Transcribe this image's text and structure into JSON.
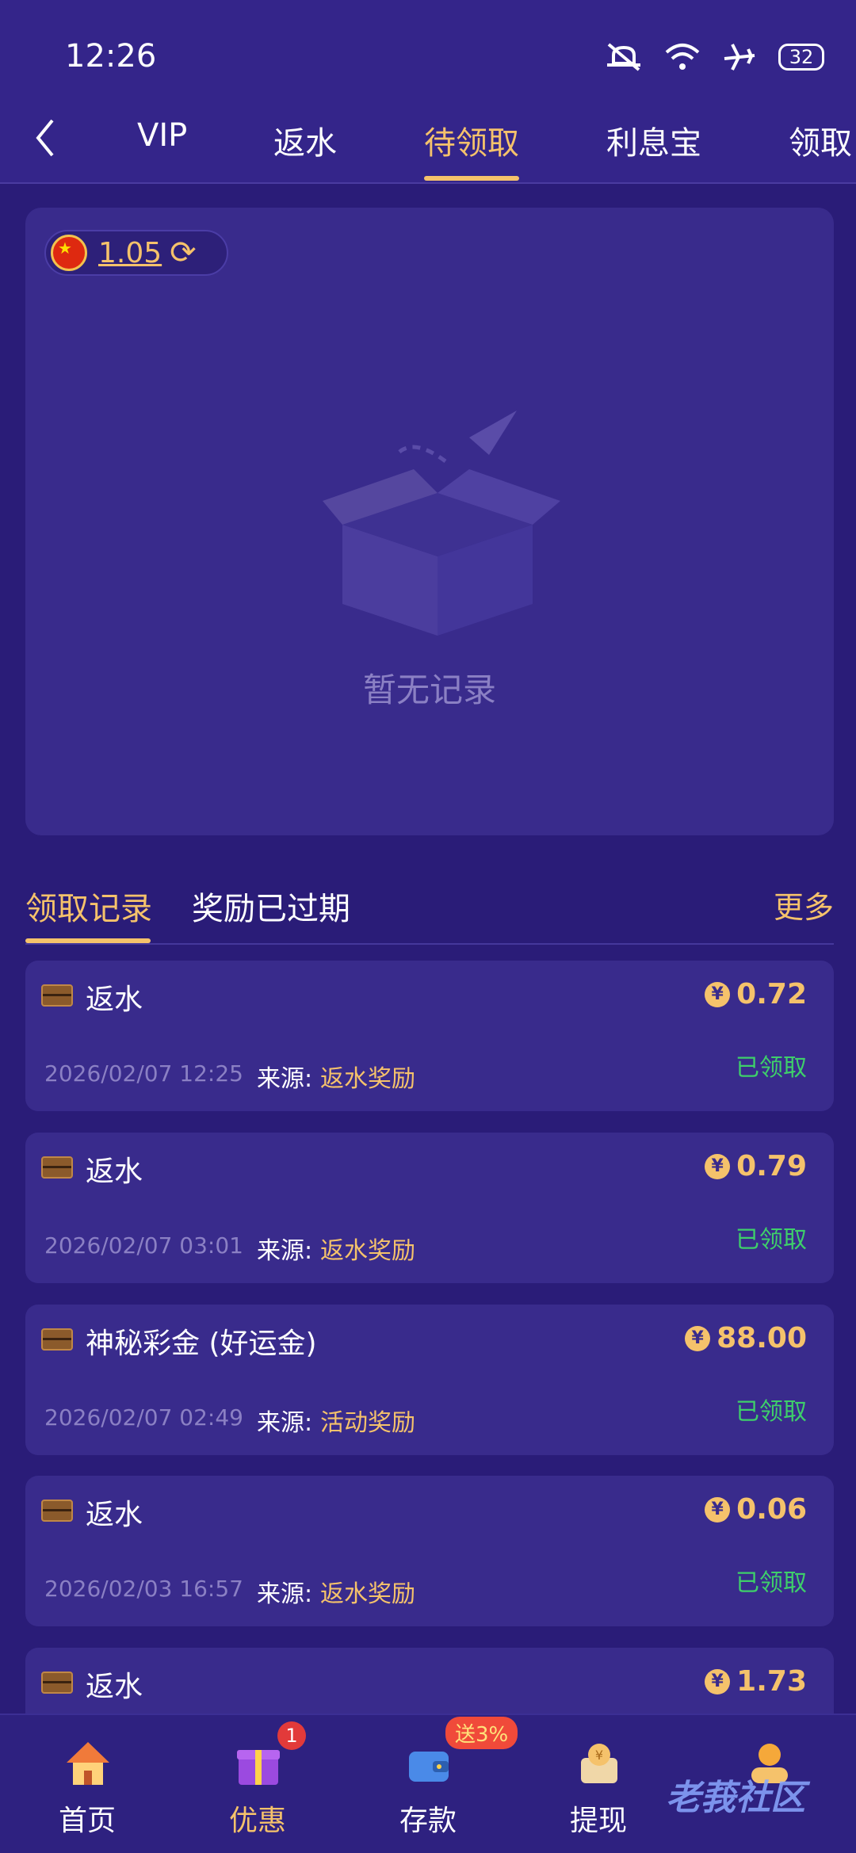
{
  "status_bar": {
    "time": "12:26",
    "battery": "32"
  },
  "tabs": [
    {
      "label": "VIP"
    },
    {
      "label": "返水"
    },
    {
      "label": "待领取"
    },
    {
      "label": "利息宝"
    },
    {
      "label": "领取"
    }
  ],
  "active_tab": "待领取",
  "balance": {
    "value": "1.05"
  },
  "empty_state": {
    "text": "暂无记录"
  },
  "section_tabs": [
    {
      "label": "领取记录"
    },
    {
      "label": "奖励已过期"
    }
  ],
  "more_label": "更多",
  "records": [
    {
      "title": "返水",
      "amount": "0.72",
      "date": "2026/02/07 12:25",
      "source_label": "来源:",
      "source": "返水奖励",
      "status": "已领取"
    },
    {
      "title": "返水",
      "amount": "0.79",
      "date": "2026/02/07 03:01",
      "source_label": "来源:",
      "source": "返水奖励",
      "status": "已领取"
    },
    {
      "title": "神秘彩金 (好运金)",
      "amount": "88.00",
      "date": "2026/02/07 02:49",
      "source_label": "来源:",
      "source": "活动奖励",
      "status": "已领取"
    },
    {
      "title": "返水",
      "amount": "0.06",
      "date": "2026/02/03 16:57",
      "source_label": "来源:",
      "source": "返水奖励",
      "status": "已领取"
    },
    {
      "title": "返水",
      "amount": "1.73"
    }
  ],
  "currency_symbol": "¥",
  "bottom_nav": [
    {
      "label": "首页",
      "icon": "home-icon"
    },
    {
      "label": "优惠",
      "icon": "gift-icon",
      "badge": "1"
    },
    {
      "label": "存款",
      "icon": "wallet-icon"
    },
    {
      "label": "提现",
      "icon": "coin-icon"
    },
    {
      "label": "",
      "icon": "profile-icon"
    }
  ],
  "promo_badge": "送3%",
  "watermark": "老莪社区",
  "colors": {
    "background": "#2a1c78",
    "panel": "#392b8c",
    "accent": "#f5c26b",
    "success": "#3ecf6a",
    "muted": "#8b80c4"
  }
}
